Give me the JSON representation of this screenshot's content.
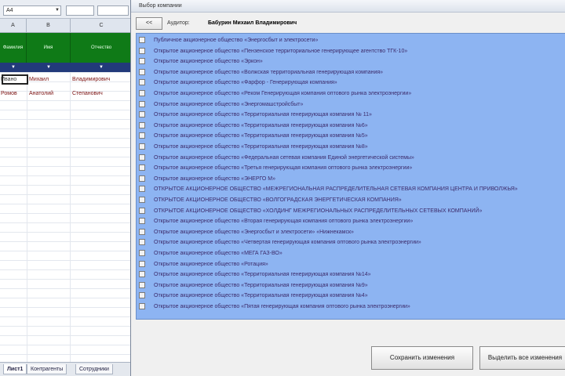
{
  "sheet": {
    "name_box": "A4",
    "columns": [
      "A",
      "B",
      "C"
    ],
    "green_headers": [
      "Фамилия",
      "Имя",
      "Отчество"
    ],
    "filter_marks": [
      "▼",
      "▼",
      "▼"
    ],
    "rows": [
      [
        "Ивано",
        "Михаил",
        "Владимирович"
      ],
      [
        "Ромов",
        "Анатолий",
        "Степанович"
      ]
    ],
    "tabs": [
      "Лист1",
      "Контрагенты",
      "Сотрудники"
    ]
  },
  "dialog": {
    "title": "Выбор компании",
    "back_button": "<<",
    "employee_label": "Аудитор:",
    "employee_name": "Бабурин Михаил Владимирович",
    "items": [
      "Публичное акционерное общество «Энергосбыт и электросети»",
      "Открытое акционерное общество «Пензенское территориальное генерирующее агентство ТГК-10»",
      "Открытое акционерное общество «Эркон»",
      "Открытое акционерное общество «Волжская территориальная генерирующая компания»",
      "Открытое акционерное общество «Фарфор - Генерирующая компания»",
      "Открытое акционерное общество «Реком Генерирующая компания оптового рынка электроэнергии»",
      "Открытое акционерное общество «Энергомашстройсбыт»",
      "Открытое акционерное общество «Территориальная генерирующая компания № 11»",
      "Открытое акционерное общество «Территориальная генерирующая компания №6»",
      "Открытое акционерное общество «Территориальная генерирующая компания №5»",
      "Открытое акционерное общество «Территориальная генерирующая компания №8»",
      "Открытое акционерное общество «Федеральная сетевая компания Единой энергетической системы»",
      "Открытое акционерное общество «Третья генерирующая компания оптового рынка электроэнергии»",
      "Открытое акционерное общество «ЭНЕРГО М»",
      "ОТКРЫТОЕ АКЦИОНЕРНОЕ ОБЩЕСТВО «МЕЖРЕГИОНАЛЬНАЯ РАСПРЕДЕЛИТЕЛЬНАЯ СЕТЕВАЯ КОМПАНИЯ ЦЕНТРА И ПРИВОЛЖЬЯ»",
      "ОТКРЫТОЕ АКЦИОНЕРНОЕ ОБЩЕСТВО «ВОЛГОГРАДСКАЯ ЭНЕРГЕТИЧЕСКАЯ КОМПАНИЯ»",
      "ОТКРЫТОЕ АКЦИОНЕРНОЕ ОБЩЕСТВО «ХОЛДИНГ МЕЖРЕГИОНАЛЬНЫХ РАСПРЕДЕЛИТЕЛЬНЫХ СЕТЕВЫХ КОМПАНИЙ»",
      "Открытое акционерное общество «Вторая генерирующая компания оптового рынка электроэнергии»",
      "Открытое акционерное общество «Энергосбыт и электросети» «Нижнекамск»",
      "Открытое акционерное общество «Четвертая генерирующая компания оптового рынка электроэнергии»",
      "Открытое акционерное общество «МЕГА ГАЗ-ВО»",
      "Открытое акционерное общество «Ротация»",
      "Открытое акционерное общество «Территориальная генерирующая компания №14»",
      "Открытое акционерное общество «Территориальная генерирующая компания №9»",
      "Открытое акционерное общество «Территориальная генерирующая компания №4»",
      "Открытое акционерное общество «Пятая генерирующая компания оптового рынка электроэнергии»"
    ],
    "buttons": {
      "save": "Сохранить изменения",
      "select_all": "Выделить все изменения"
    }
  }
}
